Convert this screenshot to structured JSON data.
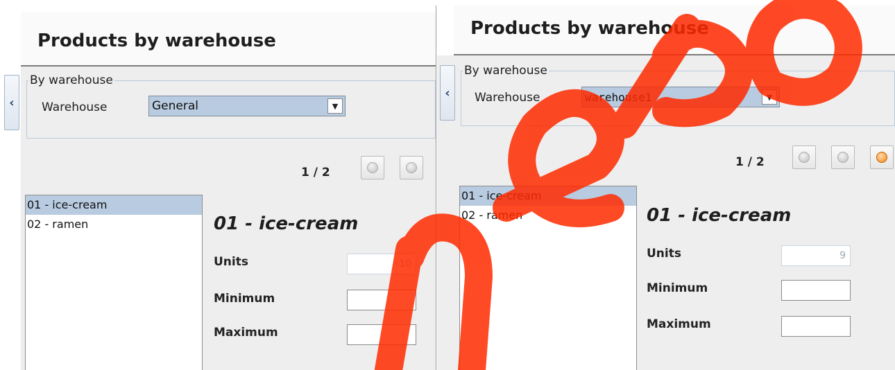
{
  "left": {
    "title": "Products by warehouse",
    "group_label": "By warehouse",
    "warehouse_label": "Warehouse",
    "warehouse_value": "General",
    "pager": "1 / 2",
    "list": [
      "01 - ice-cream",
      "02 - ramen"
    ],
    "product_title": "01 - ice-cream",
    "units_label": "Units",
    "units_value": "-10",
    "minimum_label": "Minimum",
    "minimum_value": "",
    "maximum_label": "Maximum",
    "maximum_value": ""
  },
  "right": {
    "title": "Products by warehouse",
    "group_label": "By warehouse",
    "warehouse_label": "Warehouse",
    "warehouse_value": "warehouse1",
    "pager": "1 / 2",
    "list": [
      "01 - ice-cream",
      "02 - ramen"
    ],
    "product_title": "01 - ice-cream",
    "units_label": "Units",
    "units_value": "9",
    "minimum_label": "Minimum",
    "minimum_value": "",
    "maximum_label": "Maximum",
    "maximum_value": ""
  },
  "icons": {
    "collapse": "chevron-left-icon",
    "combo_arrow": "caret-down-icon",
    "nav_buttons": "circle-button-icon"
  },
  "colors": {
    "selection": "#b8cbe0",
    "nav_active": "#f08a1a",
    "watermark": "#ff2a00"
  }
}
